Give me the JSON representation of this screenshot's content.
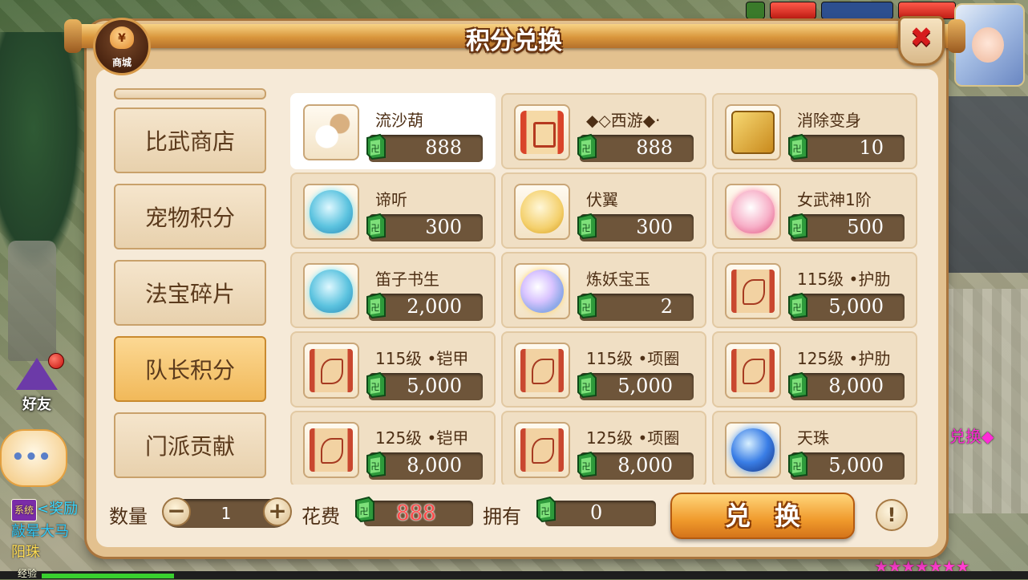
{
  "panel": {
    "title": "积分兑换",
    "shop_badge": "商城",
    "shop_glyph": "¥",
    "close_glyph": "✖"
  },
  "sidebar": {
    "items": [
      {
        "label": "比武商店",
        "active": false
      },
      {
        "label": "宠物积分",
        "active": false
      },
      {
        "label": "法宝碎片",
        "active": false
      },
      {
        "label": "队长积分",
        "active": true
      },
      {
        "label": "门派贡献",
        "active": false
      }
    ]
  },
  "items": [
    {
      "name": "流沙葫",
      "price": "888",
      "icon": "gourd-icon",
      "selected": true
    },
    {
      "name": "◆◇西游◆·",
      "price": "888",
      "icon": "scroll-icon",
      "selected": false
    },
    {
      "name": "消除变身",
      "price": "10",
      "icon": "card-icon",
      "selected": false
    },
    {
      "name": "谛听",
      "price": "300",
      "icon": "blue-egg-icon",
      "selected": false
    },
    {
      "name": "伏翼",
      "price": "300",
      "icon": "gold-egg-icon",
      "selected": false
    },
    {
      "name": "女武神1阶",
      "price": "500",
      "icon": "pink-egg-icon",
      "selected": false
    },
    {
      "name": "笛子书生",
      "price": "2,000",
      "icon": "blue-egg-icon",
      "selected": false
    },
    {
      "name": "炼妖宝玉",
      "price": "2",
      "icon": "jade-icon",
      "selected": false
    },
    {
      "name": "115级 •护肋",
      "price": "5,000",
      "icon": "parchment-icon",
      "selected": false
    },
    {
      "name": "115级 •铠甲",
      "price": "5,000",
      "icon": "parchment-icon",
      "selected": false
    },
    {
      "name": "115级 •项圈",
      "price": "5,000",
      "icon": "parchment-icon",
      "selected": false
    },
    {
      "name": "125级 •护肋",
      "price": "8,000",
      "icon": "parchment-icon",
      "selected": false
    },
    {
      "name": "125级 •铠甲",
      "price": "8,000",
      "icon": "parchment-icon",
      "selected": false
    },
    {
      "name": "125级 •项圈",
      "price": "8,000",
      "icon": "parchment-icon",
      "selected": false
    },
    {
      "name": "天珠",
      "price": "5,000",
      "icon": "pearl-icon",
      "selected": false
    }
  ],
  "footer": {
    "qty_label": "数量",
    "qty_value": "1",
    "minus": "−",
    "plus": "+",
    "cost_label": "花费",
    "cost_value": "888",
    "own_label": "拥有",
    "own_value": "0",
    "exchange_label": "兑换",
    "info_glyph": "!"
  },
  "hud": {
    "friend_label": "好友",
    "chat_dots": "•••",
    "system_tag": "系统",
    "chat_line1": "<奖励",
    "chat_line2": "敲晕大马",
    "chat_line3": "阳珠",
    "right_note": "兑换◆",
    "exp_label": "经验",
    "stars": "★★★★★★★"
  },
  "colors": {
    "accent": "#f09a2c",
    "panel": "#e3c18f",
    "price_box": "#6e553a",
    "cost_text": "#ff4a4a"
  }
}
